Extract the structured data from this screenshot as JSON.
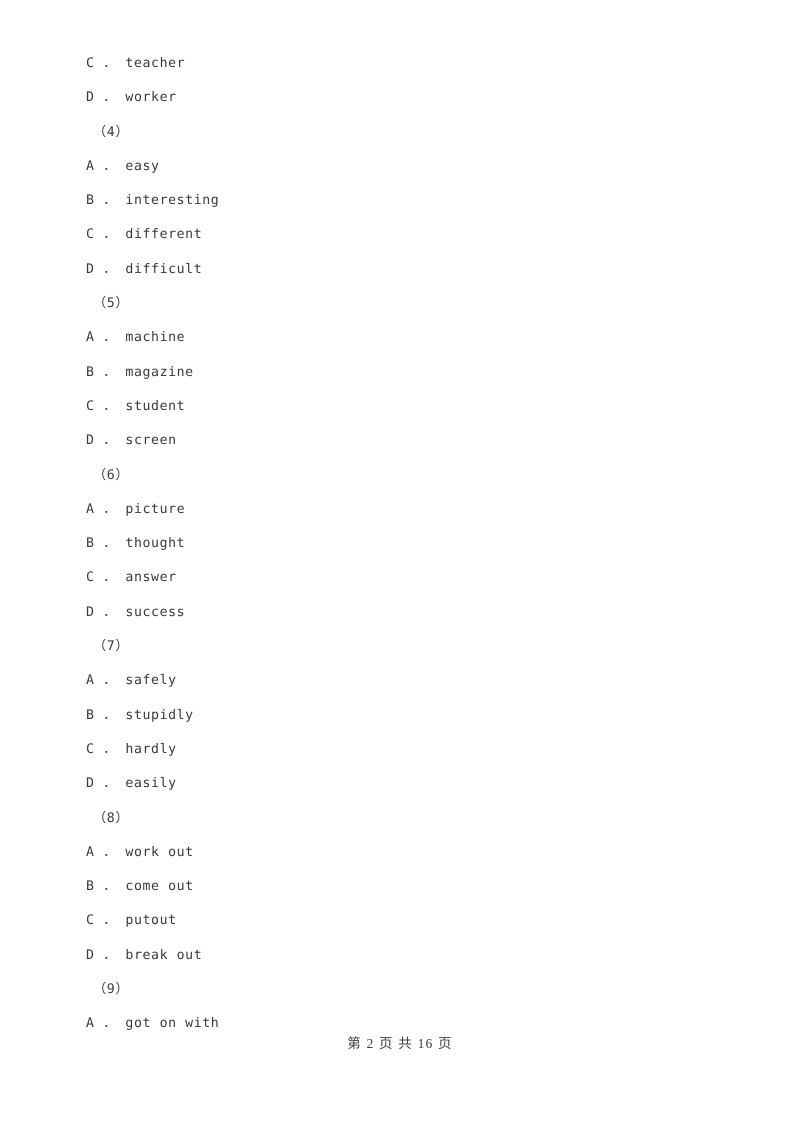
{
  "document": {
    "type": "exam-paper",
    "page_background": "#ffffff",
    "text_color": "#3a3a3a"
  },
  "body_lines": [
    {
      "kind": "option",
      "text": "C ． teacher"
    },
    {
      "kind": "option",
      "text": "D ． worker"
    },
    {
      "kind": "qnum",
      "text": "（4）"
    },
    {
      "kind": "option",
      "text": "A ． easy"
    },
    {
      "kind": "option",
      "text": "B ． interesting"
    },
    {
      "kind": "option",
      "text": "C ． different"
    },
    {
      "kind": "option",
      "text": "D ． difficult"
    },
    {
      "kind": "qnum",
      "text": "（5）"
    },
    {
      "kind": "option",
      "text": "A ． machine"
    },
    {
      "kind": "option",
      "text": "B ． magazine"
    },
    {
      "kind": "option",
      "text": "C ． student"
    },
    {
      "kind": "option",
      "text": "D ． screen"
    },
    {
      "kind": "qnum",
      "text": "（6）"
    },
    {
      "kind": "option",
      "text": "A ． picture"
    },
    {
      "kind": "option",
      "text": "B ． thought"
    },
    {
      "kind": "option",
      "text": "C ． answer"
    },
    {
      "kind": "option",
      "text": "D ． success"
    },
    {
      "kind": "qnum",
      "text": "（7）"
    },
    {
      "kind": "option",
      "text": "A ． safely"
    },
    {
      "kind": "option",
      "text": "B ． stupidly"
    },
    {
      "kind": "option",
      "text": "C ． hardly"
    },
    {
      "kind": "option",
      "text": "D ． easily"
    },
    {
      "kind": "qnum",
      "text": "（8）"
    },
    {
      "kind": "option",
      "text": "A ． work out"
    },
    {
      "kind": "option",
      "text": "B ． come out"
    },
    {
      "kind": "option",
      "text": "C ． putout"
    },
    {
      "kind": "option",
      "text": "D ． break out"
    },
    {
      "kind": "qnum",
      "text": "（9）"
    },
    {
      "kind": "option",
      "text": "A ． got on with"
    }
  ],
  "questions": [
    {
      "number": "（4）",
      "options": [
        "A ． easy",
        "B ． interesting",
        "C ． different",
        "D ． difficult"
      ]
    },
    {
      "number": "（5）",
      "options": [
        "A ． machine",
        "B ． magazine",
        "C ． student",
        "D ． screen"
      ]
    },
    {
      "number": "（6）",
      "options": [
        "A ． picture",
        "B ． thought",
        "C ． answer",
        "D ． success"
      ]
    },
    {
      "number": "（7）",
      "options": [
        "A ． safely",
        "B ． stupidly",
        "C ． hardly",
        "D ． easily"
      ]
    },
    {
      "number": "（8）",
      "options": [
        "A ． work out",
        "B ． come out",
        "C ． putout",
        "D ． break out"
      ]
    },
    {
      "number": "（9）",
      "options": [
        "A ． got on with"
      ]
    }
  ],
  "footer": {
    "text": "第 2 页 共 16 页",
    "current_page": "2",
    "total_pages": "16"
  }
}
